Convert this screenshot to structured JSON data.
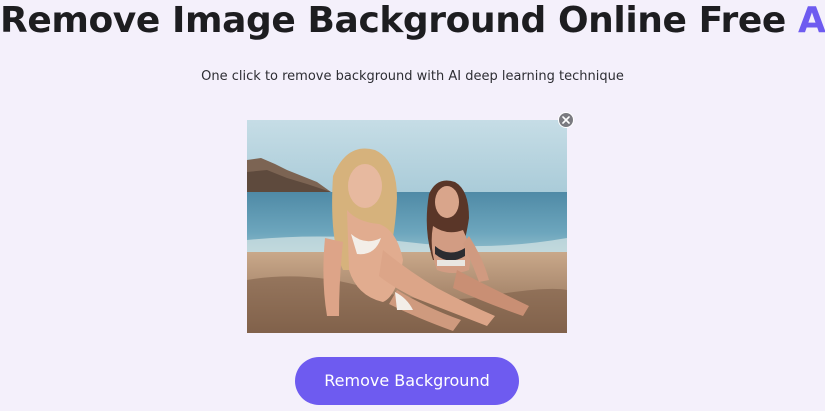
{
  "header": {
    "title_main": "Remove Image Background Online Free ",
    "title_accent": "AI",
    "subtitle": "One click to remove background with AI deep learning technique"
  },
  "preview": {
    "close_icon": "close-icon"
  },
  "actions": {
    "remove_background_label": "Remove Background"
  },
  "colors": {
    "background": "#f4f0fb",
    "accent": "#6e5bf0",
    "heading": "#1d1d20"
  }
}
